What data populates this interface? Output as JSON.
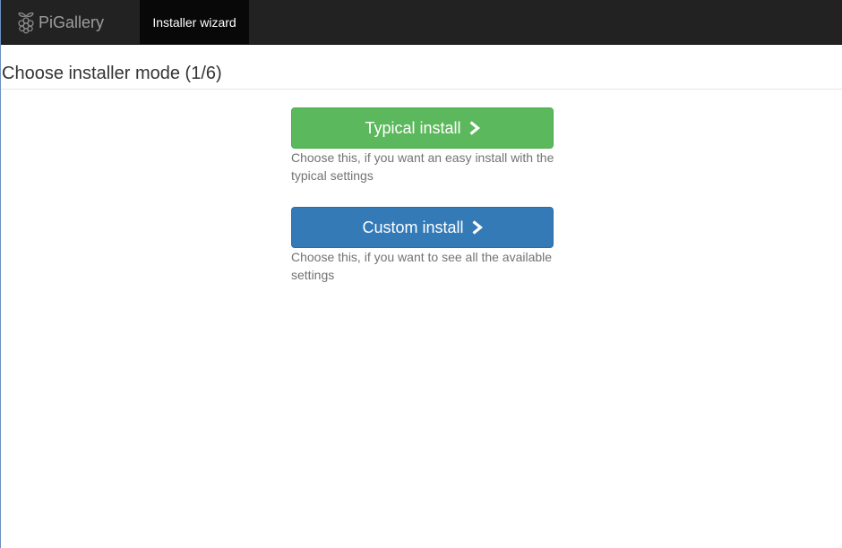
{
  "navbar": {
    "brand_name": "PiGallery",
    "brand_icon": "raspberry-icon",
    "active_tab": "Installer wizard"
  },
  "page": {
    "title": "Choose installer mode (1/6)"
  },
  "options": {
    "typical": {
      "label": "Typical install",
      "icon": "chevron-right-icon",
      "description": "Choose this, if you want an easy install with the typical settings",
      "color": "#5cb85c"
    },
    "custom": {
      "label": "Custom install",
      "icon": "chevron-right-icon",
      "description": "Choose this, if you want to see all the available settings",
      "color": "#337ab7"
    }
  }
}
